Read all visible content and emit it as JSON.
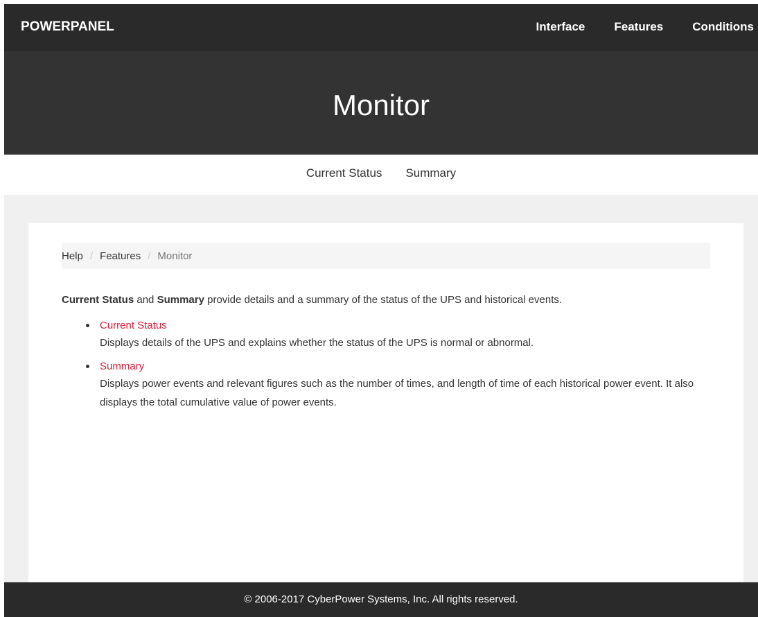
{
  "header": {
    "brand": "POWERPANEL",
    "nav": [
      "Interface",
      "Features",
      "Conditions"
    ]
  },
  "hero": {
    "title": "Monitor"
  },
  "subnav": {
    "items": [
      "Current Status",
      "Summary"
    ]
  },
  "breadcrumb": {
    "items": [
      "Help",
      "Features"
    ],
    "current": "Monitor",
    "separator": "/"
  },
  "intro": {
    "term1": "Current Status",
    "and": " and ",
    "term2": "Summary",
    "rest": " provide details and a summary of the status of the UPS and historical events."
  },
  "sections": [
    {
      "title": "Current Status",
      "description": "Displays details of the UPS and explains whether the status of the UPS is normal or abnormal."
    },
    {
      "title": "Summary",
      "description": "Displays power events and relevant figures such as the number of times, and length of time of each historical power event. It also displays the total cumulative value of power events."
    }
  ],
  "footer": {
    "copyright": "© 2006-2017 CyberPower Systems, Inc. All rights reserved."
  },
  "colors": {
    "nav_bg": "#2a2a2a",
    "hero_bg": "#333333",
    "link_red": "#d7213d",
    "content_bg": "#f0f0f0"
  }
}
